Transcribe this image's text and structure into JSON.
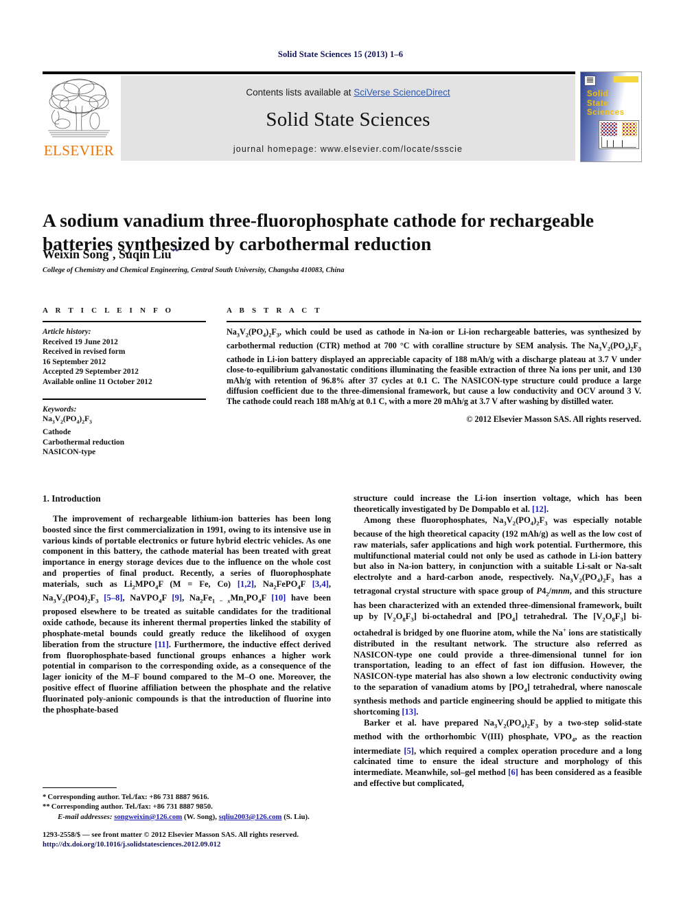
{
  "running_head": "Solid State Sciences 15 (2013) 1–6",
  "masthead": {
    "contents_prefix": "Contents lists available at ",
    "contents_link": "SciVerse ScienceDirect",
    "journal_name": "Solid State Sciences",
    "homepage": "journal homepage: www.elsevier.com/locate/ssscie",
    "publisher": "ELSEVIER"
  },
  "cover": {
    "line1": "Solid",
    "line2": "State",
    "line3": "Sciences"
  },
  "article": {
    "title": "A sodium vanadium three-fluorophosphate cathode for rechargeable batteries synthesized by carbothermal reduction",
    "authors": "Weixin Song, Suqin Liu",
    "author1_mark": "*",
    "author2_mark": "**",
    "affiliation": "College of Chemistry and Chemical Engineering, Central South University, Changsha 410083, China"
  },
  "info": {
    "heading": "A R T I C L E  I N F O",
    "history_label": "Article history:",
    "history": [
      "Received 19 June 2012",
      "Received in revised form",
      "16 September 2012",
      "Accepted 29 September 2012",
      "Available online 11 October 2012"
    ],
    "keywords_label": "Keywords:",
    "keywords": [
      "Na3V2(PO4)2F3",
      "Cathode",
      "Carbothermal reduction",
      "NASICON-type"
    ]
  },
  "abstract": {
    "heading": "A B S T R A C T",
    "text": "Na3V2(PO4)2F3, which could be used as cathode in Na-ion or Li-ion rechargeable batteries, was synthesized by carbothermal reduction (CTR) method at 700 °C with coralline structure by SEM analysis. The Na3V2(PO4)2F3 cathode in Li-ion battery displayed an appreciable capacity of 188 mAh/g with a discharge plateau at 3.7 V under close-to-equilibrium galvanostatic conditions illuminating the feasible extraction of three Na ions per unit, and 130 mAh/g with retention of 96.8% after 37 cycles at 0.1 C. The NASICON-type structure could produce a large diffusion coefficient due to the three-dimensional framework, but cause a low conductivity and OCV around 3 V. The cathode could reach 188 mAh/g at 0.1 C, with a more 20 mAh/g at 3.7 V after washing by distilled water.",
    "copyright": "© 2012 Elsevier Masson SAS. All rights reserved."
  },
  "body": {
    "section_heading": "1. Introduction",
    "left_para1": "The improvement of rechargeable lithium-ion batteries has been long boosted since the first commercialization in 1991, owing to its intensive use in various kinds of portable electronics or future hybrid electric vehicles. As one component in this battery, the cathode material has been treated with great importance in energy storage devices due to the influence on the whole cost and properties of final product. Recently, a series of fluorophosphate materials, such as Li2MPO4F (M = Fe, Co) [1,2], Na2FePO4F [3,4], Na3V2(PO4)2F3 [5–8], NaVPO4F [9], Na2Fe1 − xMnxPO4F [10] have been proposed elsewhere to be treated as suitable candidates for the traditional oxide cathode, because its inherent thermal properties linked the stability of phosphate-metal bounds could greatly reduce the likelihood of oxygen liberation from the structure [11]. Furthermore, the inductive effect derived from fluorophosphate-based functional groups enhances a higher work potential in comparison to the corresponding oxide, as a consequence of the lager ionicity of the M–F bound compared to the M–O one. Moreover, the positive effect of fluorine affiliation between the phosphate and the relative fluorinated poly-anionic compounds is that the introduction of fluorine into the phosphate-based",
    "right_para1": "structure could increase the Li-ion insertion voltage, which has been theoretically investigated by De Dompablo et al. [12].",
    "right_para2": "Among these fluorophosphates, Na3V2(PO4)2F3 was especially notable because of the high theoretical capacity (192 mAh/g) as well as the low cost of raw materials, safer applications and high work potential. Furthermore, this multifunctional material could not only be used as cathode in Li-ion battery but also in Na-ion battery, in conjunction with a suitable Li-salt or Na-salt electrolyte and a hard-carbon anode, respectively. Na3V2(PO4)2F3 has a tetragonal crystal structure with space group of P42/mnm, and this structure has been characterized with an extended three-dimensional framework, built up by [V2O8F3] bi-octahedral and [PO4] tetrahedral. The [V2O8F3] bi-octahedral is bridged by one fluorine atom, while the Na+ ions are statistically distributed in the resultant network. The structure also referred as NASICON-type one could provide a three-dimensional tunnel for ion transportation, leading to an effect of fast ion diffusion. However, the NASICON-type material has also shown a low electronic conductivity owing to the separation of vanadium atoms by [PO4] tetrahedral, where nanoscale synthesis methods and particle engineering should be applied to mitigate this shortcoming [13].",
    "right_para3": "Barker et al. have prepared Na3V2(PO4)2F3 by a two-step solid-state method with the orthorhombic V(III) phosphate, VPO4, as the reaction intermediate [5], which required a complex operation procedure and a long calcinated time to ensure the ideal structure and morphology of this intermediate. Meanwhile, sol–gel method [6] has been considered as a feasible and effective but complicated,"
  },
  "footnotes": {
    "line1": "Corresponding author. Tel./fax: +86 731 8887 9616.",
    "line1_mark": "*",
    "line2": "Corresponding author. Tel./fax: +86 731 8887 9850.",
    "line2_mark": "**",
    "email_label": "E-mail addresses:",
    "email1": "songweixin@126.com",
    "email1_name": "(W. Song),",
    "email2": "sqliu2003@126.com",
    "email2_name": "(S. Liu)."
  },
  "imprint": {
    "line1": "1293-2558/$ — see front matter © 2012 Elsevier Masson SAS. All rights reserved.",
    "doi": "http://dx.doi.org/10.1016/j.solidstatesciences.2012.09.012"
  }
}
